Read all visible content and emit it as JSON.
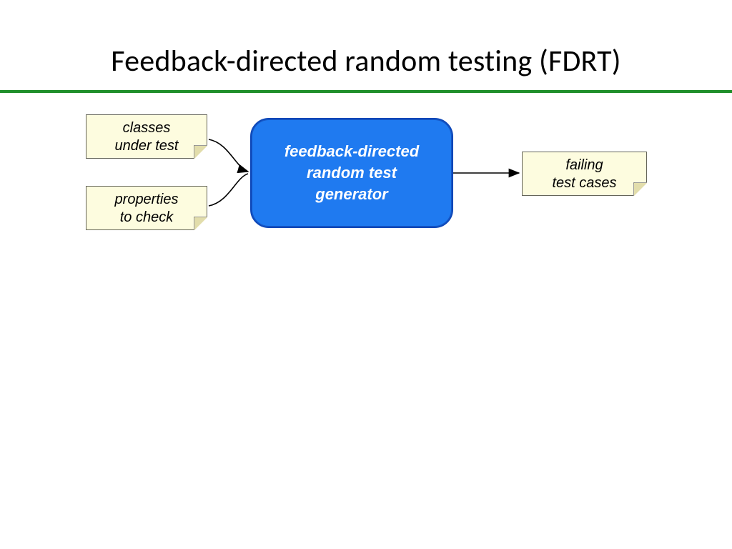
{
  "title": "Feedback-directed random testing (FDRT)",
  "notes": {
    "input_top": {
      "line1": "classes",
      "line2": "under test"
    },
    "input_bot": {
      "line1": "properties",
      "line2": "to check"
    },
    "output": {
      "line1": "failing",
      "line2": "test cases"
    }
  },
  "generator": {
    "line1": "feedback-directed",
    "line2": "random test",
    "line3": "generator"
  },
  "colors": {
    "rule": "#1f8f2b",
    "note_bg": "#fdfcdf",
    "gen_bg": "#1f7af0"
  }
}
